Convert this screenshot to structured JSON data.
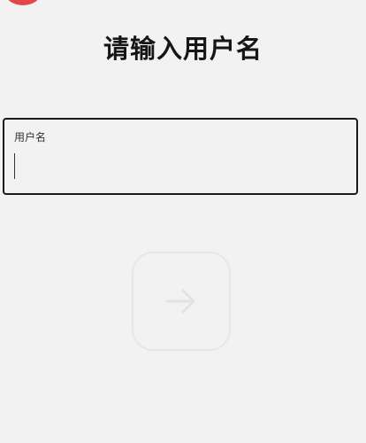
{
  "page": {
    "title": "请输入用户名"
  },
  "username_field": {
    "label": "用户名",
    "value": "",
    "placeholder": ""
  },
  "next_button": {
    "icon": "arrow-right-icon",
    "enabled": false
  },
  "colors": {
    "background": "#f2f2f2",
    "badge": "#e4474a",
    "field_border": "#1a1a1a",
    "disabled_button_border": "#e6e6e6",
    "disabled_icon": "#e2e2e2"
  }
}
